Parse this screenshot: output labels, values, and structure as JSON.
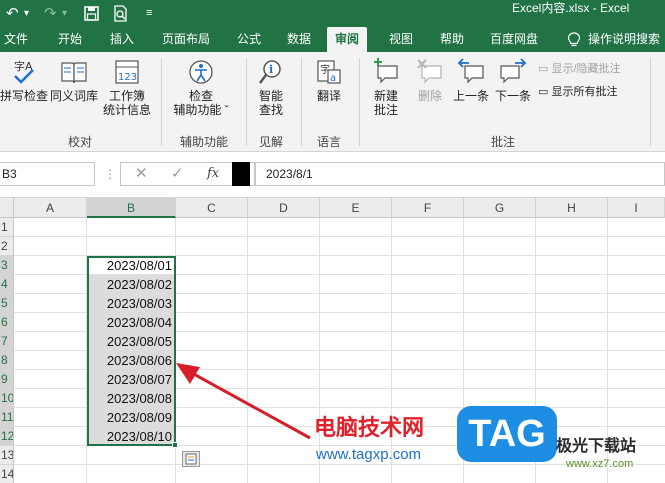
{
  "titlebar": {
    "title": "Excel内容.xlsx  -  Excel",
    "undo_icon": "undo-icon",
    "redo_icon": "redo-icon",
    "save_icon": "save-icon",
    "print_preview_icon": "print-preview-icon",
    "customize_icon": "qat-customize-icon"
  },
  "tabs": [
    {
      "label": "文件"
    },
    {
      "label": "开始"
    },
    {
      "label": "插入"
    },
    {
      "label": "页面布局"
    },
    {
      "label": "公式"
    },
    {
      "label": "数据"
    },
    {
      "label": "审阅",
      "active": true
    },
    {
      "label": "视图"
    },
    {
      "label": "帮助"
    },
    {
      "label": "百度网盘"
    },
    {
      "label": "操作说明搜索"
    }
  ],
  "ribbon": {
    "proofing": {
      "label": "校对",
      "spell": "拼写检查",
      "thesaurus": "同义词库",
      "stats_line1": "工作簿",
      "stats_line2": "统计信息"
    },
    "accessibility": {
      "label": "辅助功能",
      "check_line1": "检查",
      "check_line2": "辅助功能 ˇ"
    },
    "insights": {
      "label": "见解",
      "smart_line1": "智能",
      "smart_line2": "查找"
    },
    "language": {
      "label": "语言",
      "translate": "翻译"
    },
    "comments": {
      "label": "批注",
      "new_line1": "新建",
      "new_line2": "批注",
      "delete": "删除",
      "prev": "上一条",
      "next": "下一条",
      "show_hide": "显示/隐藏批注",
      "show_all": "显示所有批注"
    }
  },
  "formula_bar": {
    "name_box": "B3",
    "cancel_glyph": "✕",
    "enter_glyph": "✓",
    "fx_glyph": "fx",
    "formula": "2023/8/1"
  },
  "grid": {
    "columns": [
      "A",
      "B",
      "C",
      "D",
      "E",
      "F",
      "G",
      "H",
      "I"
    ],
    "selected_column": "B",
    "rows": [
      "1",
      "2",
      "3",
      "4",
      "5",
      "6",
      "7",
      "8",
      "9",
      "10",
      "11",
      "12",
      "13",
      "14"
    ],
    "values": [
      "2023/08/01",
      "2023/08/02",
      "2023/08/03",
      "2023/08/04",
      "2023/08/05",
      "2023/08/06",
      "2023/08/07",
      "2023/08/08",
      "2023/08/09",
      "2023/08/10"
    ]
  },
  "watermark": {
    "cn_text": "电脑技术网",
    "url": "www.tagxp.com",
    "logo": "TAG",
    "site": "极光下载站",
    "site_url": "www.xz7.com"
  },
  "colors": {
    "excel_green": "#217346",
    "arrow_red": "#d81e28",
    "logo_blue": "#1d8ee4"
  }
}
